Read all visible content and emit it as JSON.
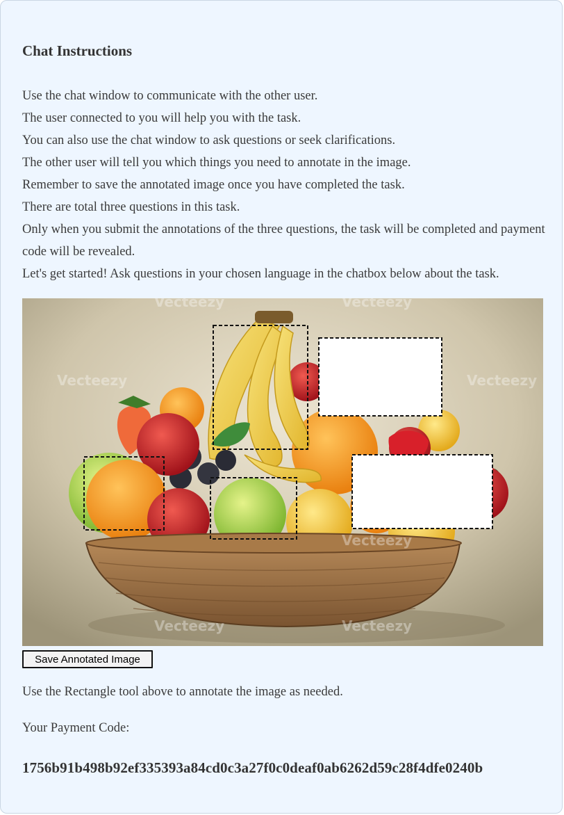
{
  "chat": {
    "title": "Chat Instructions",
    "lines": [
      "Use the chat window to communicate with the other user.",
      "The user connected to you will help you with the task.",
      "You can also use the chat window to ask questions or seek clarifications.",
      "The other user will tell you which things you need to annotate in the image.",
      "Remember to save the annotated image once you have completed the task.",
      "There are total three questions in this task.",
      "Only when you submit the annotations of the three questions, the task will be completed and payment code will be revealed.",
      "Let's get started! Ask questions in your chosen language in the chatbox below about the task."
    ]
  },
  "image": {
    "watermark": "Vecteezy"
  },
  "toolbar": {
    "save_label": "Save Annotated Image"
  },
  "hint": "Use the Rectangle tool above to annotate the image as needed.",
  "payment": {
    "label": "Your Payment Code:",
    "code": "1756b91b498b92ef335393a84cd0c3a27f0c0deaf0ab6262d59c28f4dfe0240b"
  },
  "colors": {
    "panel_bg": "#eef6ff",
    "text": "#333333"
  }
}
